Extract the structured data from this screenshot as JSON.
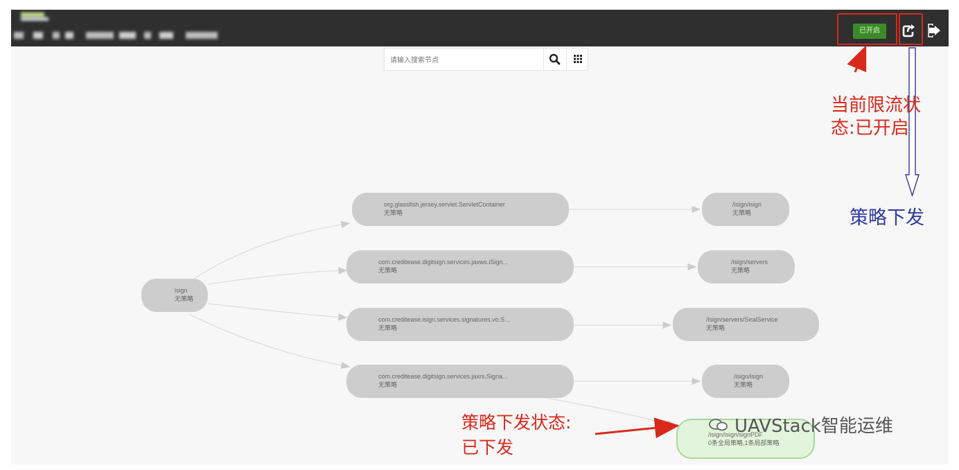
{
  "header": {
    "status_button_label": "已开启"
  },
  "search": {
    "placeholder": "请输入搜索节点"
  },
  "icons": {
    "search": "search-icon",
    "grid": "grid-icon",
    "publish": "share-icon",
    "logout": "logout-icon"
  },
  "graph": {
    "nodes": [
      {
        "id": "root",
        "name": "isign",
        "sub": "无策略"
      },
      {
        "id": "c1",
        "name": "org.glassfish.jersey.servlet.ServletContainer",
        "sub": "无策略"
      },
      {
        "id": "c2",
        "name": "com.creditease.digitsign.services.jaxws.iSign...",
        "sub": "无策略"
      },
      {
        "id": "c3",
        "name": "com.creditease.isign.services.signatures.vo.S...",
        "sub": "无策略"
      },
      {
        "id": "c4",
        "name": "com.creditease.digitsign.services.jaxrs.Signa...",
        "sub": "无策略"
      },
      {
        "id": "l1",
        "name": "/isign/isign",
        "sub": "无策略"
      },
      {
        "id": "l2",
        "name": "/isign/servers",
        "sub": "无策略"
      },
      {
        "id": "l3",
        "name": "/isign/servers/SealService",
        "sub": "无策略"
      },
      {
        "id": "l4",
        "name": "/isign/isign",
        "sub": "无策略"
      },
      {
        "id": "l5",
        "name": "/isign/isign/signPDF",
        "sub": "0条全局策略,1条局部策略"
      }
    ]
  },
  "annotations": {
    "status_line1": "当前限流状",
    "status_line2": "态:已开启",
    "publish": "策略下发",
    "publish_status_line1": "策略下发状态:",
    "publish_status_line2": "已下发"
  },
  "watermark": "UAVStack智能运维",
  "colors": {
    "annotation_red": "#d9291c",
    "annotation_blue": "#2f3b9e",
    "status_on": "#3b8a2a",
    "active_node": "#a6d79a"
  }
}
